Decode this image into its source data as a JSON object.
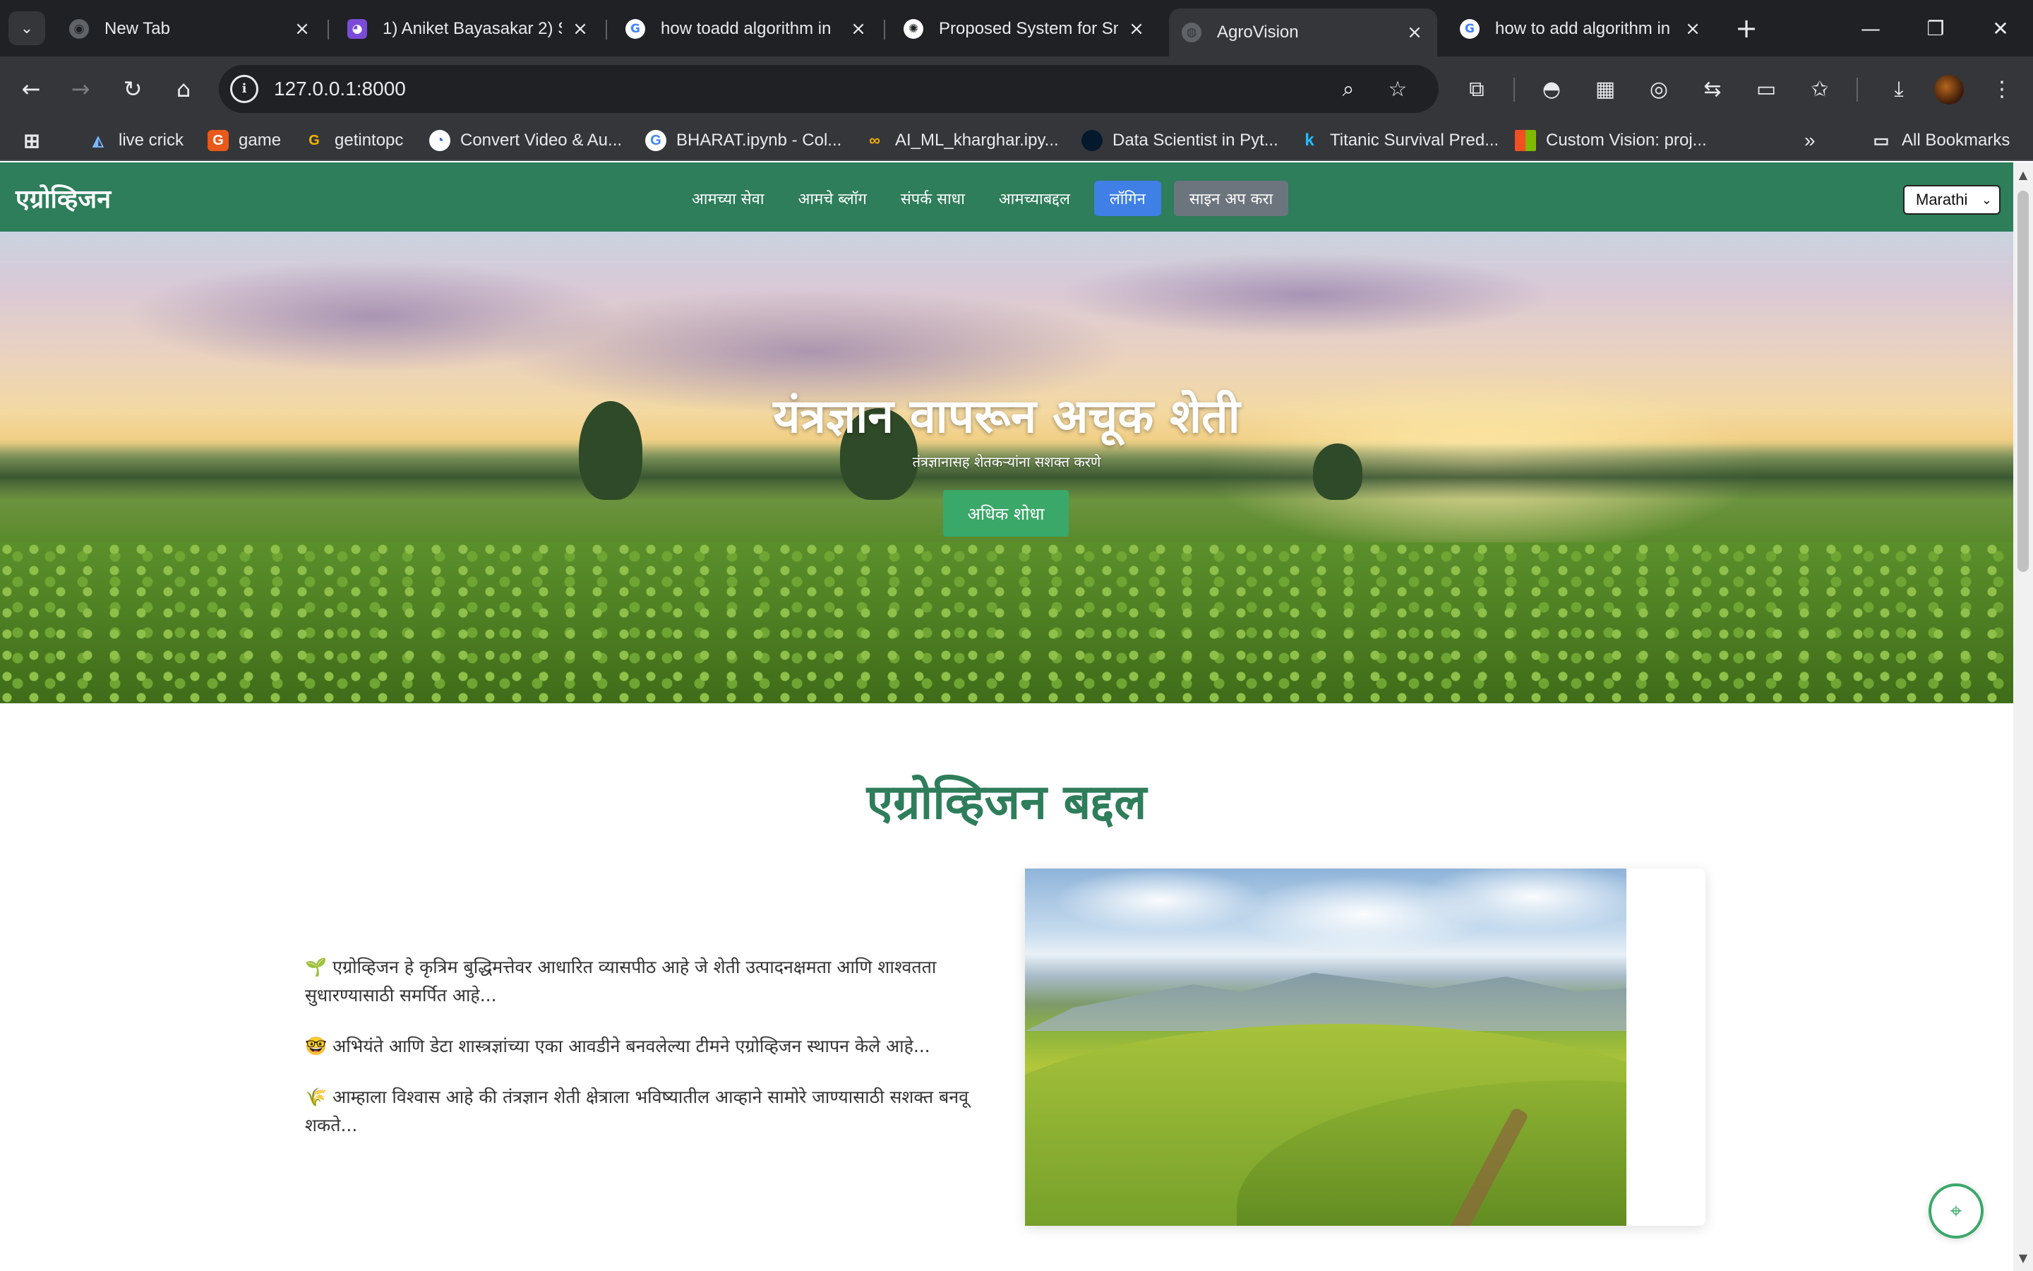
{
  "browser": {
    "tabs": [
      {
        "title": "New Tab",
        "icon": "new-tab-favicon",
        "active": false
      },
      {
        "title": "1) Aniket Bayasakar 2) S",
        "icon": "app-favicon",
        "active": false
      },
      {
        "title": "how toadd algorithm in",
        "icon": "google-favicon",
        "active": false
      },
      {
        "title": "Proposed System for Sm",
        "icon": "openai-favicon",
        "active": false
      },
      {
        "title": "AgroVision",
        "icon": "globe-favicon",
        "active": true
      },
      {
        "title": "how to add algorithm in",
        "icon": "google-favicon",
        "active": false
      }
    ],
    "url": "127.0.0.1:8000",
    "bookmarks": [
      {
        "label": "live crick",
        "icon": "cricket-favicon"
      },
      {
        "label": "game",
        "icon": "gt-favicon"
      },
      {
        "label": "getintopc",
        "icon": "g-favicon"
      },
      {
        "label": "Convert Video & Au...",
        "icon": "convert-favicon"
      },
      {
        "label": "BHARAT.ipynb - Col...",
        "icon": "google-favicon"
      },
      {
        "label": "AI_ML_kharghar.ipy...",
        "icon": "colab-favicon"
      },
      {
        "label": "Data Scientist in Pyt...",
        "icon": "datacamp-favicon"
      },
      {
        "label": "Titanic Survival Pred...",
        "icon": "kaggle-favicon"
      },
      {
        "label": "Custom Vision: proj...",
        "icon": "microsoft-favicon"
      }
    ],
    "all_bookmarks": "All Bookmarks"
  },
  "site": {
    "brand": "एग्रोव्हिजन",
    "nav": [
      "आमच्या सेवा",
      "आमचे ब्लॉग",
      "संपर्क साधा",
      "आमच्याबद्दल"
    ],
    "login": "लॉगिन",
    "signup": "साइन अप करा",
    "language": "Marathi",
    "hero": {
      "title": "यंत्रज्ञान वापरून अचूक शेती",
      "subtitle": "तंत्रज्ञानासह शेतकऱ्यांना सशक्त करणे",
      "button": "अधिक शोधा"
    },
    "about": {
      "title": "एग्रोव्हिजन बद्दल",
      "paragraphs": [
        {
          "emoji": "🌱",
          "text": "एग्रोव्हिजन हे कृत्रिम बुद्धिमत्तेवर आधारित व्यासपीठ आहे जे शेती उत्पादनक्षमता आणि शाश्वतता सुधारण्यासाठी समर्पित आहे..."
        },
        {
          "emoji": "🤓",
          "text": "अभियंते आणि डेटा शास्त्रज्ञांच्या एका आवडीने बनवलेल्या टीमने एग्रोव्हिजन स्थापन केले आहे..."
        },
        {
          "emoji": "🌾",
          "text": "आम्हाला विश्वास आहे की तंत्रज्ञान शेती क्षेत्राला भविष्यातील आव्हाने सामोरे जाण्यासाठी सशक्त बनवू शकते..."
        }
      ]
    }
  },
  "colors": {
    "nav_green": "#2e7d5b",
    "hero_button": "#3aa869",
    "login_blue": "#3f7fe6",
    "signup_gray": "#6c757d"
  }
}
